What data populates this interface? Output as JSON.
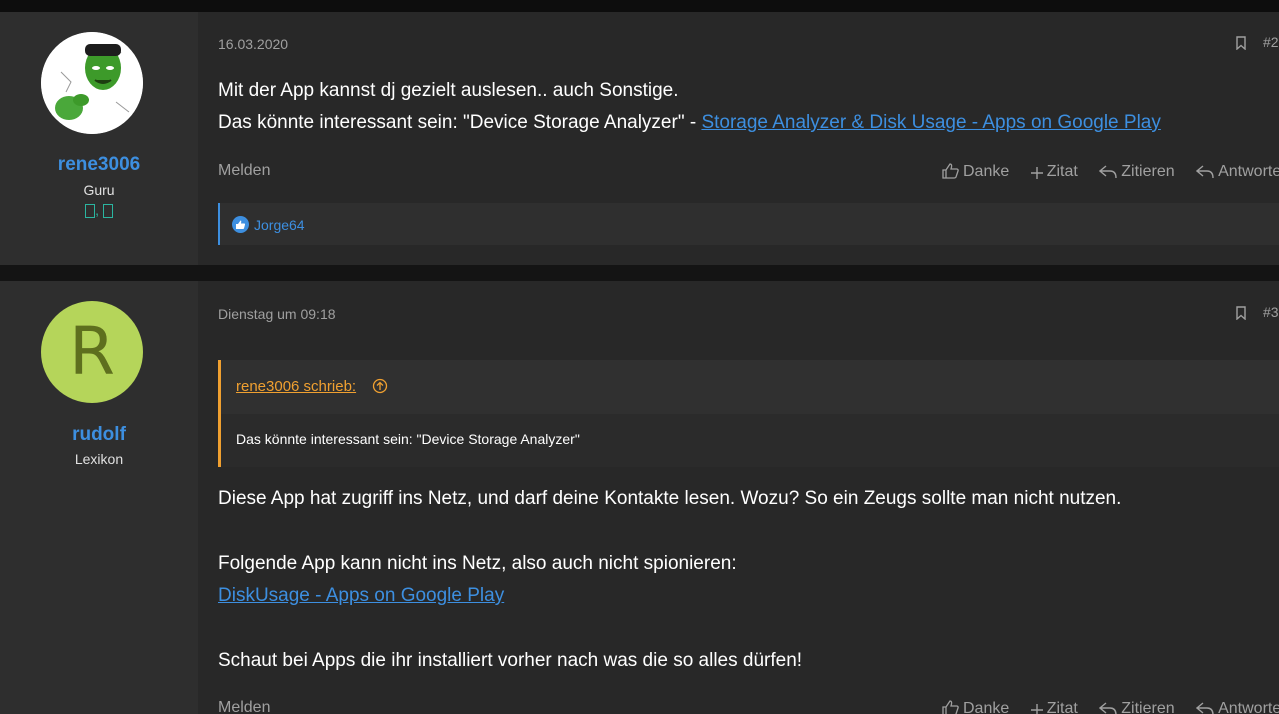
{
  "posts": [
    {
      "user": {
        "name": "rene3006",
        "title": "Guru",
        "badge_separator": ","
      },
      "date": "16.03.2020",
      "number": "#2",
      "lines": [
        {
          "text": "Mit der App kannst dj gezielt auslesen.. auch Sonstige."
        },
        {
          "text": "Das könnte interessant sein: \"Device Storage Analyzer\" - ",
          "link": "Storage Analyzer & Disk Usage - Apps on Google Play"
        }
      ],
      "report_label": "Melden",
      "reactions": {
        "users": "Jorge64"
      }
    },
    {
      "user": {
        "name": "rudolf",
        "title": "Lexikon",
        "avatar_letter": "R"
      },
      "date": "Dienstag um 09:18",
      "number": "#3",
      "quote": {
        "author": "rene3006 schrieb:",
        "text": "Das könnte interessant sein: \"Device Storage Analyzer\""
      },
      "paragraphs": [
        "Diese App hat zugriff ins Netz, und darf deine Kontakte lesen. Wozu? So ein Zeugs sollte man nicht nutzen.",
        "Folgende App kann nicht ins Netz, also auch nicht spionieren:",
        "DiskUsage - Apps on Google Play",
        "Schaut bei Apps die ihr installiert vorher nach was die so alles dürfen!"
      ],
      "report_label": "Melden"
    }
  ],
  "actions": {
    "like": "Danke",
    "multiquote": "Zitat",
    "quote": "Zitieren",
    "reply": "Antworten"
  },
  "colors": {
    "link": "#3d8fe0",
    "quote_accent": "#f0a030",
    "badge": "#2bb5a0",
    "avatar_r": "#b5d55a"
  }
}
